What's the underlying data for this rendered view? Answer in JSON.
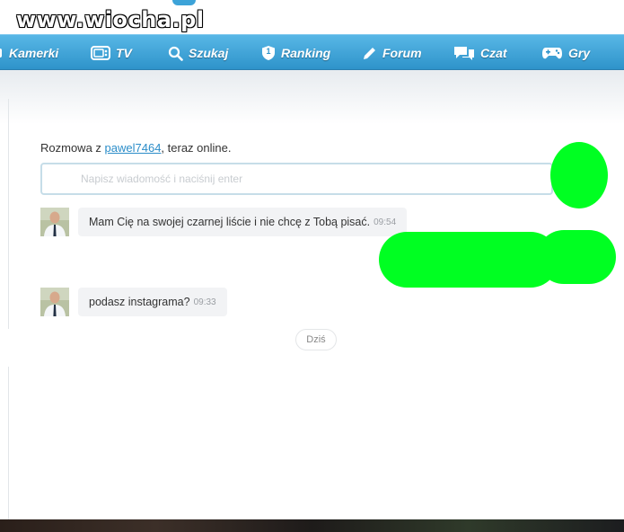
{
  "watermark": {
    "text": "www.wiocha.pl"
  },
  "nav": {
    "items": [
      {
        "label": "Kamerki",
        "icon": "camera-icon"
      },
      {
        "label": "TV",
        "icon": "tv-icon"
      },
      {
        "label": "Szukaj",
        "icon": "search-icon"
      },
      {
        "label": "Ranking",
        "icon": "shield-badge-icon"
      },
      {
        "label": "Forum",
        "icon": "pencil-icon"
      },
      {
        "label": "Czat",
        "icon": "chat-bubbles-icon"
      },
      {
        "label": "Gry",
        "icon": "gamepad-icon"
      }
    ],
    "ranking_badge": "1"
  },
  "conversation": {
    "prefix": "Rozmowa z ",
    "username": "pawel7464",
    "suffix": ", teraz online.",
    "input_placeholder": "Napisz wiadomość i naciśnij enter",
    "messages": [
      {
        "text": "Mam Cię na swojej czarnej liście i nie chcę z Tobą pisać.",
        "time": "09:54"
      },
      {
        "text": "podasz instagrama?",
        "time": "09:33"
      }
    ],
    "day_label": "Dziś"
  },
  "colors": {
    "nav_top": "#58b7e6",
    "nav_bottom": "#2e93ca",
    "link": "#2b8dc9",
    "censor_blob": "#00ff22",
    "bubble_bg": "#f2f3f5"
  }
}
